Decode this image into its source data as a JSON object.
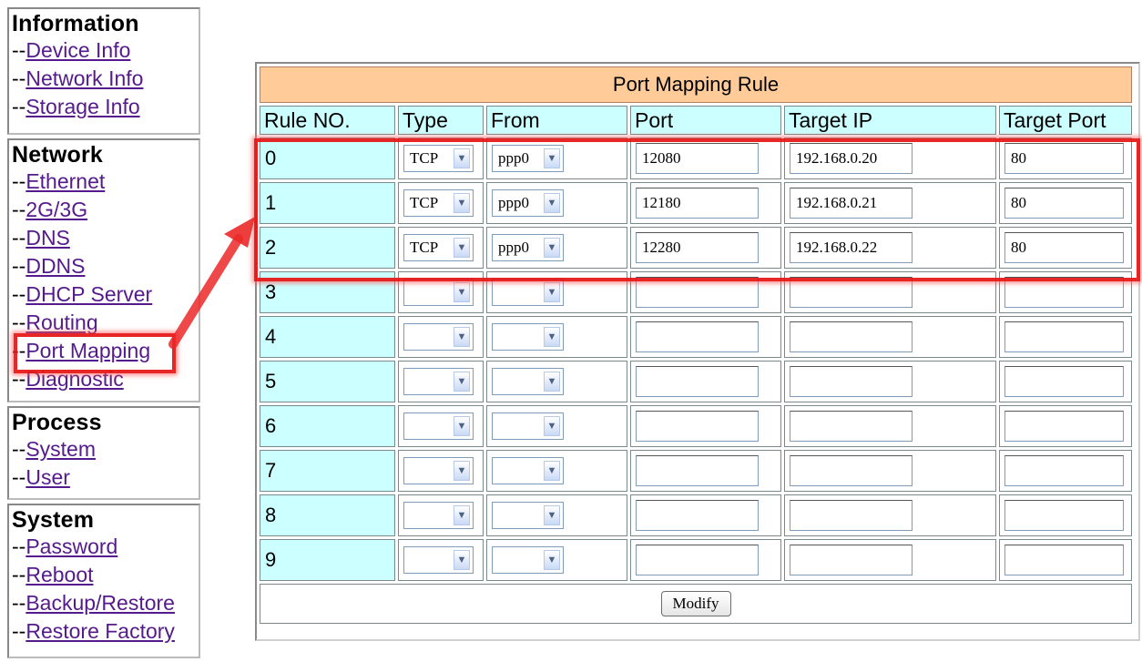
{
  "sidebar": {
    "sections": [
      {
        "title": "Information",
        "links": [
          "Device Info",
          "Network Info",
          "Storage Info"
        ]
      },
      {
        "title": "Network",
        "links": [
          "Ethernet",
          "2G/3G",
          "DNS",
          "DDNS",
          "DHCP Server",
          "Routing",
          "Port Mapping",
          "Diagnostic"
        ]
      },
      {
        "title": "Process",
        "links": [
          "System",
          "User"
        ]
      },
      {
        "title": "System",
        "links": [
          "Password",
          "Reboot",
          "Backup/Restore",
          "Restore Factory"
        ]
      }
    ],
    "link_prefix": "--"
  },
  "table": {
    "title": "Port Mapping Rule",
    "columns": [
      "Rule NO.",
      "Type",
      "From",
      "Port",
      "Target IP",
      "Target Port"
    ],
    "rows": [
      {
        "no": "0",
        "type": "TCP",
        "from": "ppp0",
        "port": "12080",
        "target_ip": "192.168.0.20",
        "target_port": "80"
      },
      {
        "no": "1",
        "type": "TCP",
        "from": "ppp0",
        "port": "12180",
        "target_ip": "192.168.0.21",
        "target_port": "80"
      },
      {
        "no": "2",
        "type": "TCP",
        "from": "ppp0",
        "port": "12280",
        "target_ip": "192.168.0.22",
        "target_port": "80"
      },
      {
        "no": "3",
        "type": "",
        "from": "",
        "port": "",
        "target_ip": "",
        "target_port": ""
      },
      {
        "no": "4",
        "type": "",
        "from": "",
        "port": "",
        "target_ip": "",
        "target_port": ""
      },
      {
        "no": "5",
        "type": "",
        "from": "",
        "port": "",
        "target_ip": "",
        "target_port": ""
      },
      {
        "no": "6",
        "type": "",
        "from": "",
        "port": "",
        "target_ip": "",
        "target_port": ""
      },
      {
        "no": "7",
        "type": "",
        "from": "",
        "port": "",
        "target_ip": "",
        "target_port": ""
      },
      {
        "no": "8",
        "type": "",
        "from": "",
        "port": "",
        "target_ip": "",
        "target_port": ""
      },
      {
        "no": "9",
        "type": "",
        "from": "",
        "port": "",
        "target_ip": "",
        "target_port": ""
      }
    ],
    "button_label": "Modify"
  },
  "colors": {
    "title_bg": "#FFCC99",
    "header_bg": "#CCFFFF",
    "link": "#551A8B",
    "highlight": "#E61414"
  }
}
